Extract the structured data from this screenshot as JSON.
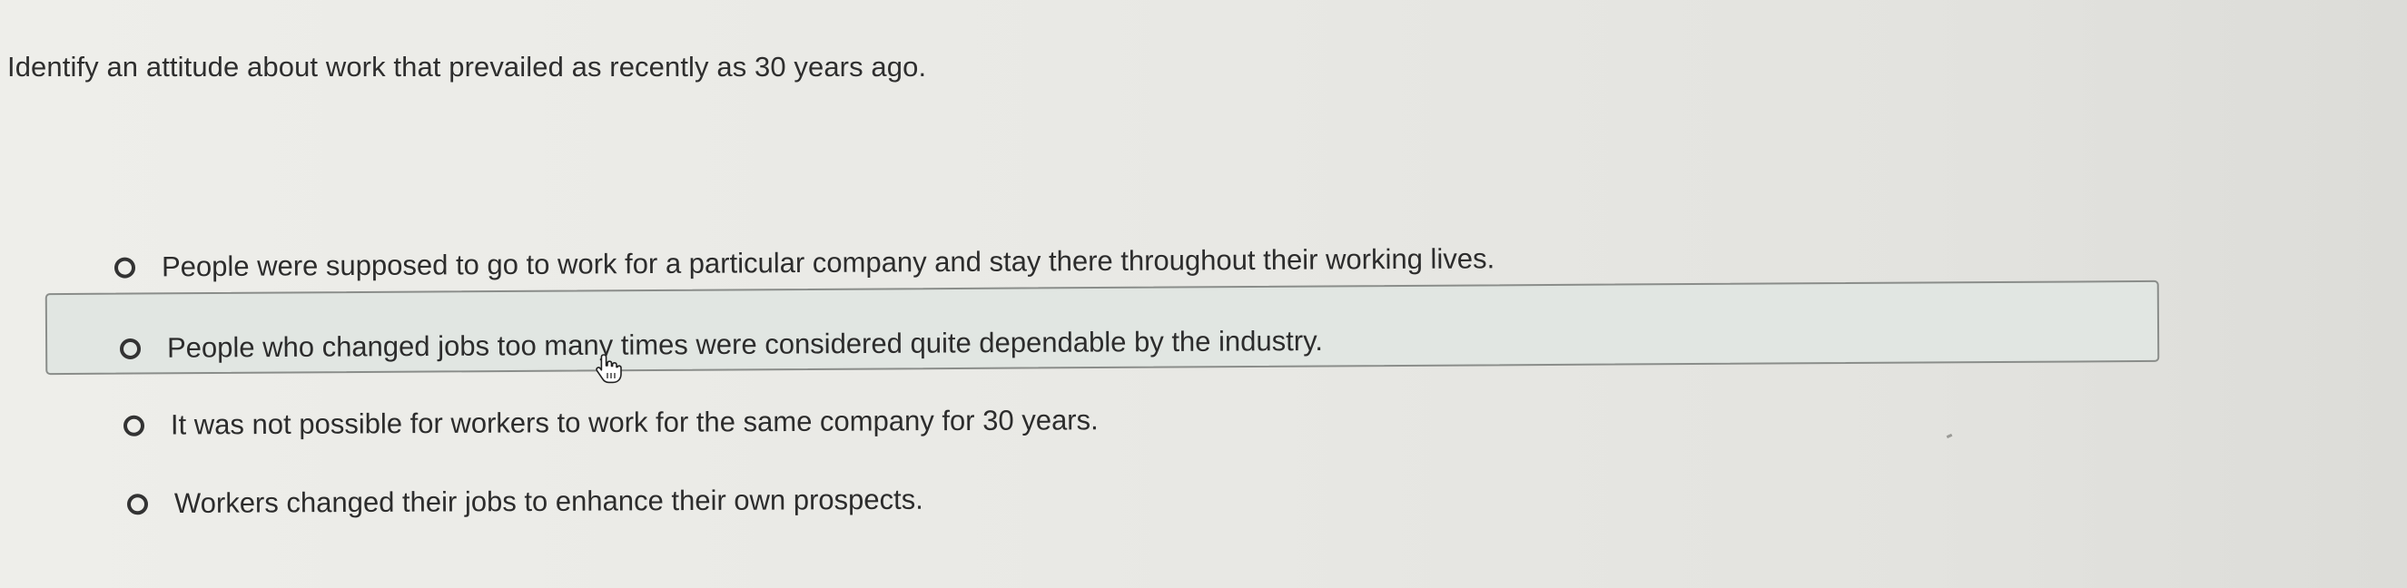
{
  "question": {
    "text": "Identify an attitude about work that prevailed as recently as 30 years ago."
  },
  "options": [
    {
      "label": "People were supposed to go to work for a particular company and stay there throughout their working lives.",
      "selected": false
    },
    {
      "label": "People who changed jobs too many times were considered quite dependable by the industry.",
      "selected": false,
      "hovered": true
    },
    {
      "label": "It was not possible for workers to work for the same company for 30 years.",
      "selected": false
    },
    {
      "label": "Workers changed their jobs to enhance their own prospects.",
      "selected": false
    }
  ],
  "cursor": {
    "icon": "hand-pointer-icon"
  },
  "colors": {
    "hover_background": "#e1e6e2",
    "hover_border": "#8a8d8a",
    "radio_border": "#333333"
  }
}
